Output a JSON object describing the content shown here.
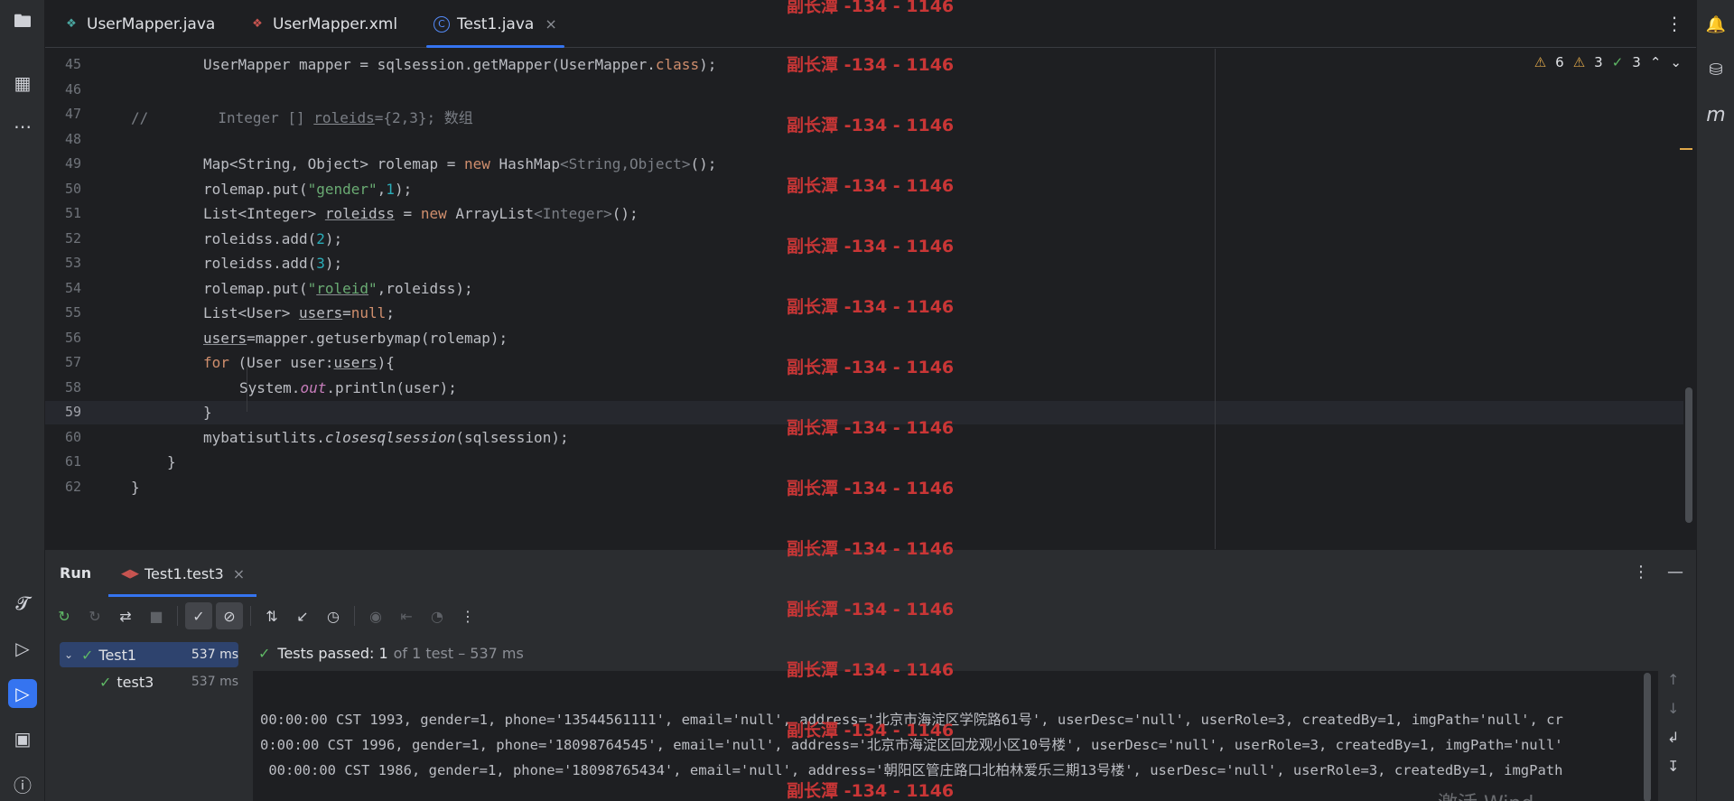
{
  "tabs": [
    {
      "label": "UserMapper.java",
      "icon": "mapper-java-icon"
    },
    {
      "label": "UserMapper.xml",
      "icon": "mybatis-xml-icon"
    },
    {
      "label": "Test1.java",
      "icon": "java-class-icon"
    }
  ],
  "inspections": {
    "warnings": "6",
    "weak_warnings": "3",
    "ok": "3"
  },
  "line_numbers": [
    "45",
    "46",
    "47",
    "48",
    "49",
    "50",
    "51",
    "52",
    "53",
    "54",
    "55",
    "56",
    "57",
    "58",
    "59",
    "60",
    "61",
    "62"
  ],
  "run_panel": {
    "title": "Run",
    "config_tab": "Test1.test3",
    "status_main": "Tests passed: 1",
    "status_rest": "of 1 test – 537 ms"
  },
  "tree": [
    {
      "label": "Test1",
      "time": "537 ms"
    },
    {
      "label": "test3",
      "time": "537 ms"
    }
  ],
  "console_lines": [
    "00:00:00 CST 1993, gender=1, phone='13544561111', email='null', address='北京市海淀区学院路61号', userDesc='null', userRole=3, createdBy=1, imgPath='null', cr",
    "0:00:00 CST 1996, gender=1, phone='18098764545', email='null', address='北京市海淀区回龙观小区10号楼', userDesc='null', userRole=3, createdBy=1, imgPath='null'",
    " 00:00:00 CST 1986, gender=1, phone='18098765434', email='null', address='朝阳区管庄路口北柏林爱乐三期13号楼', userDesc='null', userRole=3, createdBy=1, imgPath"
  ],
  "watermark": "副长潭 -134 - 1146",
  "activate_text": "激活 Wind"
}
